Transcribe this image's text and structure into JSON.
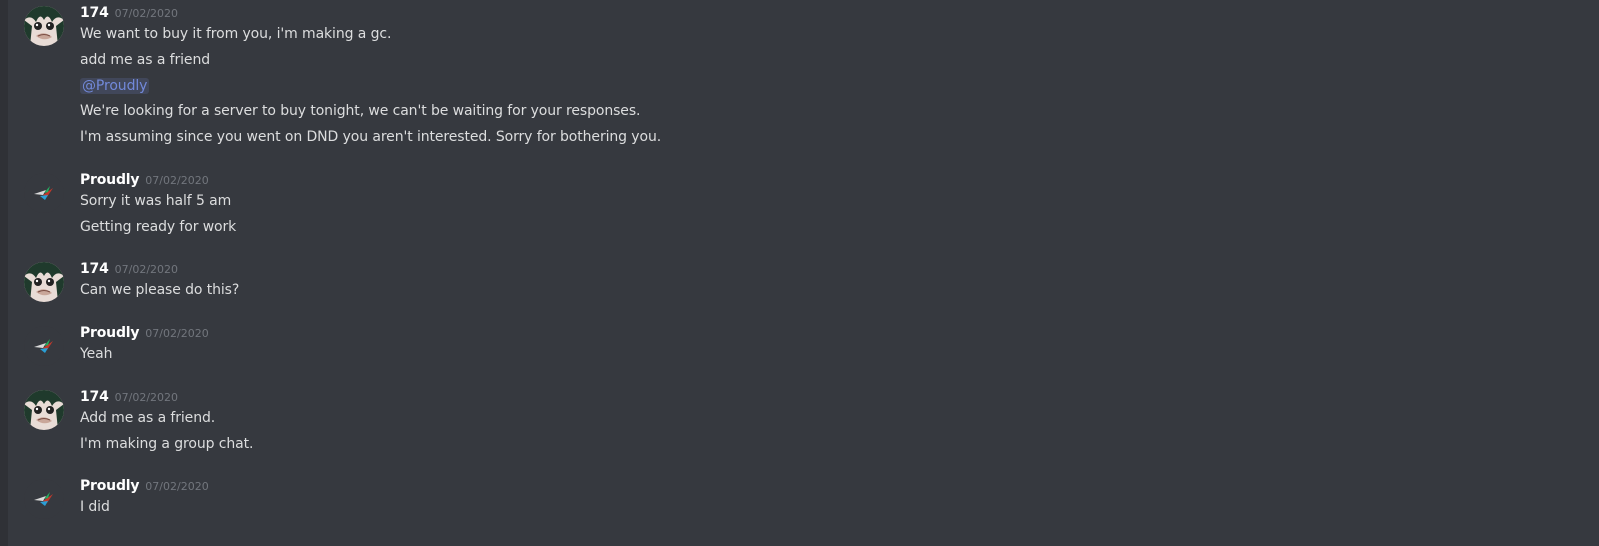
{
  "colors": {
    "background": "#36393f",
    "rail": "#2f3136",
    "username": "#ffffff",
    "timestamp": "#72767d",
    "message_text": "#dcddde",
    "mention_text": "#7289da"
  },
  "messages": [
    {
      "author": "174",
      "avatar_icon": "frog-girl-avatar",
      "timestamp": "07/02/2020",
      "lines": [
        "We want to buy it from you, i'm making a gc.",
        "add me as a friend",
        "@Proudly",
        "We're looking for a server to buy tonight, we can't be waiting for your responses.",
        "I'm assuming since you went on DND you aren't interested. Sorry for bothering you."
      ]
    },
    {
      "author": "Proudly",
      "avatar_icon": "bird-logo-avatar",
      "timestamp": "07/02/2020",
      "lines": [
        "Sorry it was half 5 am",
        "Getting ready for work"
      ]
    },
    {
      "author": "174",
      "avatar_icon": "frog-girl-avatar",
      "timestamp": "07/02/2020",
      "lines": [
        "Can we please do this?"
      ]
    },
    {
      "author": "Proudly",
      "avatar_icon": "bird-logo-avatar",
      "timestamp": "07/02/2020",
      "lines": [
        "Yeah"
      ]
    },
    {
      "author": "174",
      "avatar_icon": "frog-girl-avatar",
      "timestamp": "07/02/2020",
      "lines": [
        "Add me as a friend.",
        "I'm making a group chat."
      ]
    },
    {
      "author": "Proudly",
      "avatar_icon": "bird-logo-avatar",
      "timestamp": "07/02/2020",
      "lines": [
        "I did"
      ]
    }
  ]
}
